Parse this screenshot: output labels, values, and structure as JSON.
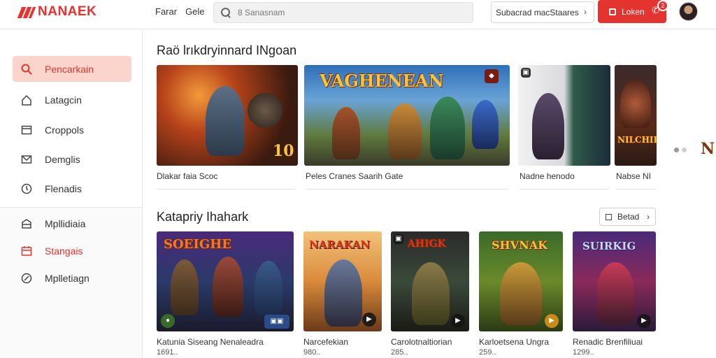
{
  "header": {
    "logo_text": "NANAEK",
    "links": [
      "Farar",
      "Gele"
    ],
    "search_placeholder": "8 Sanasnam",
    "filter_label": "Subacrad macStaares",
    "login_label": "Loken",
    "notification_count": "2"
  },
  "sidebar": {
    "items": [
      {
        "label": "Pencarkain",
        "icon": "search-icon",
        "state": "active"
      },
      {
        "label": "Latagcin",
        "icon": "home-icon"
      },
      {
        "label": "Croppols",
        "icon": "window-icon"
      },
      {
        "label": "Demglis",
        "icon": "mail-icon"
      },
      {
        "label": "Flenadis",
        "icon": "clock-icon"
      }
    ],
    "lower_items": [
      {
        "label": "Mpllidiaia",
        "icon": "box-icon"
      },
      {
        "label": "Stangais",
        "icon": "calendar-icon",
        "accent": "#e3342f"
      },
      {
        "label": "Mplletiagn",
        "icon": "compass-icon"
      }
    ]
  },
  "featured": {
    "title": "Raö lrıkdryinnard INgoan",
    "cards": [
      {
        "caption": "Dlakar faia Scoc",
        "badge": "10"
      },
      {
        "caption": "Peles Cranes Saarih Gate",
        "art_title": "VAGHENEAN"
      },
      {
        "caption": "Nadne henodo"
      },
      {
        "caption": "Nabse NI",
        "art_title": "NILCHIR"
      }
    ]
  },
  "category": {
    "title": "Katapriy Ihahark",
    "more_label": "Betad",
    "cards": [
      {
        "caption": "Katunia Siseang Nenaleadra",
        "sub": "1691..",
        "art_title": "SOEIGHE"
      },
      {
        "caption": "Narcefekian",
        "sub": "980..",
        "art_title": "NARAKAN"
      },
      {
        "caption": "Carolotnaltiorian",
        "sub": "285..",
        "art_title": "AHIGK"
      },
      {
        "caption": "Karloetsena Ungra",
        "sub": "259..",
        "art_title": "SHVNAK"
      },
      {
        "caption": "Renadic Brenfiliuai",
        "sub": "1299..",
        "art_title": "SUIRKIG"
      }
    ]
  },
  "colors": {
    "accent": "#e3342f",
    "active_bg": "#fbd4cc"
  }
}
